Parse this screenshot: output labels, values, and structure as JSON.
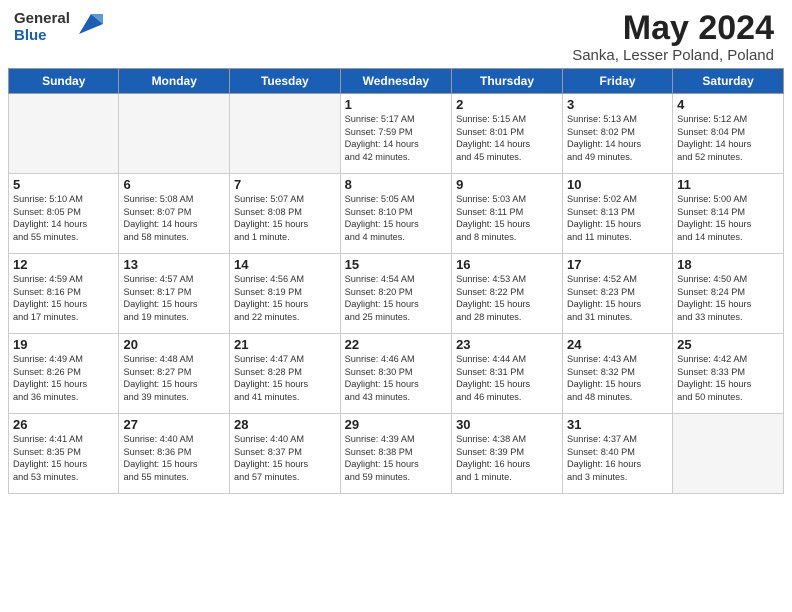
{
  "header": {
    "logo_general": "General",
    "logo_blue": "Blue",
    "main_title": "May 2024",
    "sub_title": "Sanka, Lesser Poland, Poland"
  },
  "calendar": {
    "days_of_week": [
      "Sunday",
      "Monday",
      "Tuesday",
      "Wednesday",
      "Thursday",
      "Friday",
      "Saturday"
    ],
    "weeks": [
      [
        {
          "day": "",
          "info": ""
        },
        {
          "day": "",
          "info": ""
        },
        {
          "day": "",
          "info": ""
        },
        {
          "day": "1",
          "info": "Sunrise: 5:17 AM\nSunset: 7:59 PM\nDaylight: 14 hours\nand 42 minutes."
        },
        {
          "day": "2",
          "info": "Sunrise: 5:15 AM\nSunset: 8:01 PM\nDaylight: 14 hours\nand 45 minutes."
        },
        {
          "day": "3",
          "info": "Sunrise: 5:13 AM\nSunset: 8:02 PM\nDaylight: 14 hours\nand 49 minutes."
        },
        {
          "day": "4",
          "info": "Sunrise: 5:12 AM\nSunset: 8:04 PM\nDaylight: 14 hours\nand 52 minutes."
        }
      ],
      [
        {
          "day": "5",
          "info": "Sunrise: 5:10 AM\nSunset: 8:05 PM\nDaylight: 14 hours\nand 55 minutes."
        },
        {
          "day": "6",
          "info": "Sunrise: 5:08 AM\nSunset: 8:07 PM\nDaylight: 14 hours\nand 58 minutes."
        },
        {
          "day": "7",
          "info": "Sunrise: 5:07 AM\nSunset: 8:08 PM\nDaylight: 15 hours\nand 1 minute."
        },
        {
          "day": "8",
          "info": "Sunrise: 5:05 AM\nSunset: 8:10 PM\nDaylight: 15 hours\nand 4 minutes."
        },
        {
          "day": "9",
          "info": "Sunrise: 5:03 AM\nSunset: 8:11 PM\nDaylight: 15 hours\nand 8 minutes."
        },
        {
          "day": "10",
          "info": "Sunrise: 5:02 AM\nSunset: 8:13 PM\nDaylight: 15 hours\nand 11 minutes."
        },
        {
          "day": "11",
          "info": "Sunrise: 5:00 AM\nSunset: 8:14 PM\nDaylight: 15 hours\nand 14 minutes."
        }
      ],
      [
        {
          "day": "12",
          "info": "Sunrise: 4:59 AM\nSunset: 8:16 PM\nDaylight: 15 hours\nand 17 minutes."
        },
        {
          "day": "13",
          "info": "Sunrise: 4:57 AM\nSunset: 8:17 PM\nDaylight: 15 hours\nand 19 minutes."
        },
        {
          "day": "14",
          "info": "Sunrise: 4:56 AM\nSunset: 8:19 PM\nDaylight: 15 hours\nand 22 minutes."
        },
        {
          "day": "15",
          "info": "Sunrise: 4:54 AM\nSunset: 8:20 PM\nDaylight: 15 hours\nand 25 minutes."
        },
        {
          "day": "16",
          "info": "Sunrise: 4:53 AM\nSunset: 8:22 PM\nDaylight: 15 hours\nand 28 minutes."
        },
        {
          "day": "17",
          "info": "Sunrise: 4:52 AM\nSunset: 8:23 PM\nDaylight: 15 hours\nand 31 minutes."
        },
        {
          "day": "18",
          "info": "Sunrise: 4:50 AM\nSunset: 8:24 PM\nDaylight: 15 hours\nand 33 minutes."
        }
      ],
      [
        {
          "day": "19",
          "info": "Sunrise: 4:49 AM\nSunset: 8:26 PM\nDaylight: 15 hours\nand 36 minutes."
        },
        {
          "day": "20",
          "info": "Sunrise: 4:48 AM\nSunset: 8:27 PM\nDaylight: 15 hours\nand 39 minutes."
        },
        {
          "day": "21",
          "info": "Sunrise: 4:47 AM\nSunset: 8:28 PM\nDaylight: 15 hours\nand 41 minutes."
        },
        {
          "day": "22",
          "info": "Sunrise: 4:46 AM\nSunset: 8:30 PM\nDaylight: 15 hours\nand 43 minutes."
        },
        {
          "day": "23",
          "info": "Sunrise: 4:44 AM\nSunset: 8:31 PM\nDaylight: 15 hours\nand 46 minutes."
        },
        {
          "day": "24",
          "info": "Sunrise: 4:43 AM\nSunset: 8:32 PM\nDaylight: 15 hours\nand 48 minutes."
        },
        {
          "day": "25",
          "info": "Sunrise: 4:42 AM\nSunset: 8:33 PM\nDaylight: 15 hours\nand 50 minutes."
        }
      ],
      [
        {
          "day": "26",
          "info": "Sunrise: 4:41 AM\nSunset: 8:35 PM\nDaylight: 15 hours\nand 53 minutes."
        },
        {
          "day": "27",
          "info": "Sunrise: 4:40 AM\nSunset: 8:36 PM\nDaylight: 15 hours\nand 55 minutes."
        },
        {
          "day": "28",
          "info": "Sunrise: 4:40 AM\nSunset: 8:37 PM\nDaylight: 15 hours\nand 57 minutes."
        },
        {
          "day": "29",
          "info": "Sunrise: 4:39 AM\nSunset: 8:38 PM\nDaylight: 15 hours\nand 59 minutes."
        },
        {
          "day": "30",
          "info": "Sunrise: 4:38 AM\nSunset: 8:39 PM\nDaylight: 16 hours\nand 1 minute."
        },
        {
          "day": "31",
          "info": "Sunrise: 4:37 AM\nSunset: 8:40 PM\nDaylight: 16 hours\nand 3 minutes."
        },
        {
          "day": "",
          "info": ""
        }
      ]
    ]
  }
}
